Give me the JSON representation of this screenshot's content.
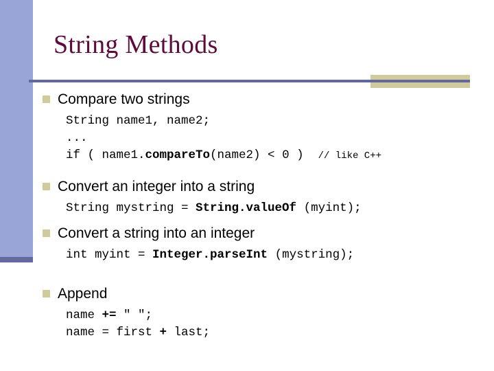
{
  "slide": {
    "title": "String Methods",
    "theme": {
      "sidebar_color": "#98a5d6",
      "sidebar_foot_color": "#64699e",
      "divider_color": "#62679c",
      "accent_block_color": "#cfcb9b",
      "bullet_color": "#cfcb9b",
      "title_color": "#5e0b39",
      "body_text_color": "#000000",
      "background_color": "#ffffff"
    },
    "bullets": [
      {
        "label": "Compare two strings",
        "code": [
          [
            {
              "text": "String name1, name2;",
              "bold": false
            }
          ],
          [
            {
              "text": "...",
              "bold": false
            }
          ],
          [
            {
              "text": "if ( name1.",
              "bold": false
            },
            {
              "text": "compareTo",
              "bold": true
            },
            {
              "text": "(name2) < 0 )  ",
              "bold": false
            },
            {
              "text": "// like C++",
              "bold": false,
              "small": true
            }
          ]
        ]
      },
      {
        "label": "Convert an integer into a string",
        "code": [
          [
            {
              "text": "String mystring = ",
              "bold": false
            },
            {
              "text": "String.valueOf",
              "bold": true
            },
            {
              "text": " (myint);",
              "bold": false
            }
          ]
        ]
      },
      {
        "label": "Convert a string into an integer",
        "code": [
          [
            {
              "text": "int myint = ",
              "bold": false
            },
            {
              "text": "Integer.parseInt",
              "bold": true
            },
            {
              "text": " (mystring);",
              "bold": false
            }
          ]
        ]
      },
      {
        "label": "Append",
        "code": [
          [
            {
              "text": "name ",
              "bold": false
            },
            {
              "text": "+=",
              "bold": true
            },
            {
              "text": " \" \";",
              "bold": false
            }
          ],
          [
            {
              "text": "name = first ",
              "bold": false
            },
            {
              "text": "+",
              "bold": true
            },
            {
              "text": " last;",
              "bold": false
            }
          ]
        ]
      }
    ]
  }
}
